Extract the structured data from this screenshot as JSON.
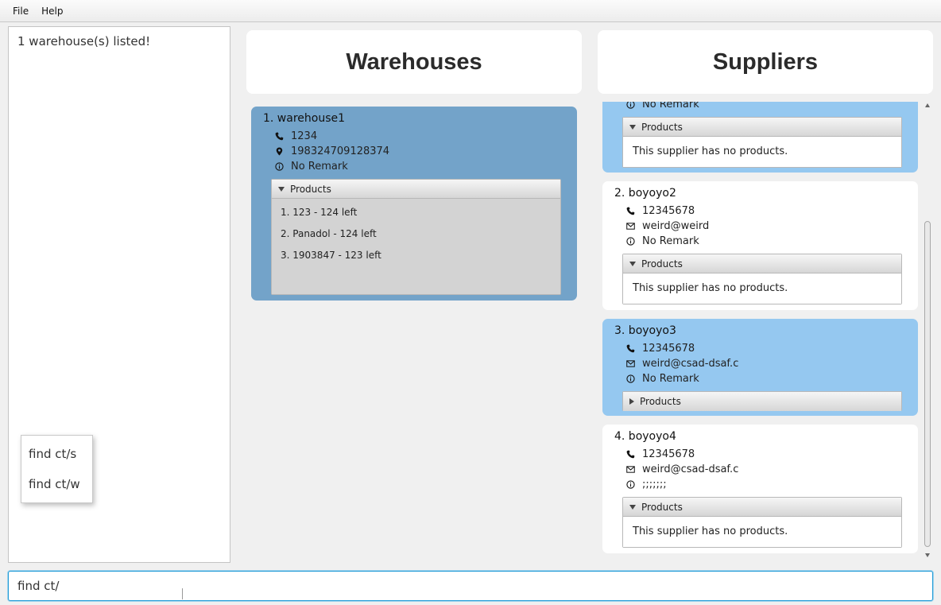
{
  "menu": {
    "file": "File",
    "help": "Help"
  },
  "result": {
    "message": "1 warehouse(s) listed!"
  },
  "autocomplete": {
    "items": [
      "find ct/s",
      "find ct/w"
    ]
  },
  "headers": {
    "warehouses": "Warehouses",
    "suppliers": "Suppliers"
  },
  "warehouse": {
    "index_name": "1.  warehouse1",
    "phone": "1234",
    "address": "198324709128374",
    "remark": "No Remark",
    "products_label": "Products",
    "products": [
      "1. 123 - 124 left",
      "2. Panadol - 124 left",
      "3. 1903847 - 123 left"
    ]
  },
  "suppliers": [
    {
      "remark": "No Remark",
      "products_label": "Products",
      "no_products": "This supplier has no products."
    },
    {
      "index_name": "2.  boyoyo2",
      "phone": "12345678",
      "email": "weird@weird",
      "remark": "No Remark",
      "products_label": "Products",
      "no_products": "This supplier has no products."
    },
    {
      "index_name": "3.  boyoyo3",
      "phone": "12345678",
      "email": "weird@csad-dsaf.c",
      "remark": "No Remark",
      "products_label": "Products"
    },
    {
      "index_name": "4.  boyoyo4",
      "phone": "12345678",
      "email": "weird@csad-dsaf.c",
      "remark": ";;;;;;;",
      "products_label": "Products",
      "no_products": "This supplier has no products."
    }
  ],
  "command": {
    "value": "find ct/"
  },
  "colors": {
    "warehouse_card": "#73a3c9",
    "supplier_highlight": "#95c8f0",
    "supplier_plain": "#ffffff",
    "accent": "#1f9ad6"
  }
}
